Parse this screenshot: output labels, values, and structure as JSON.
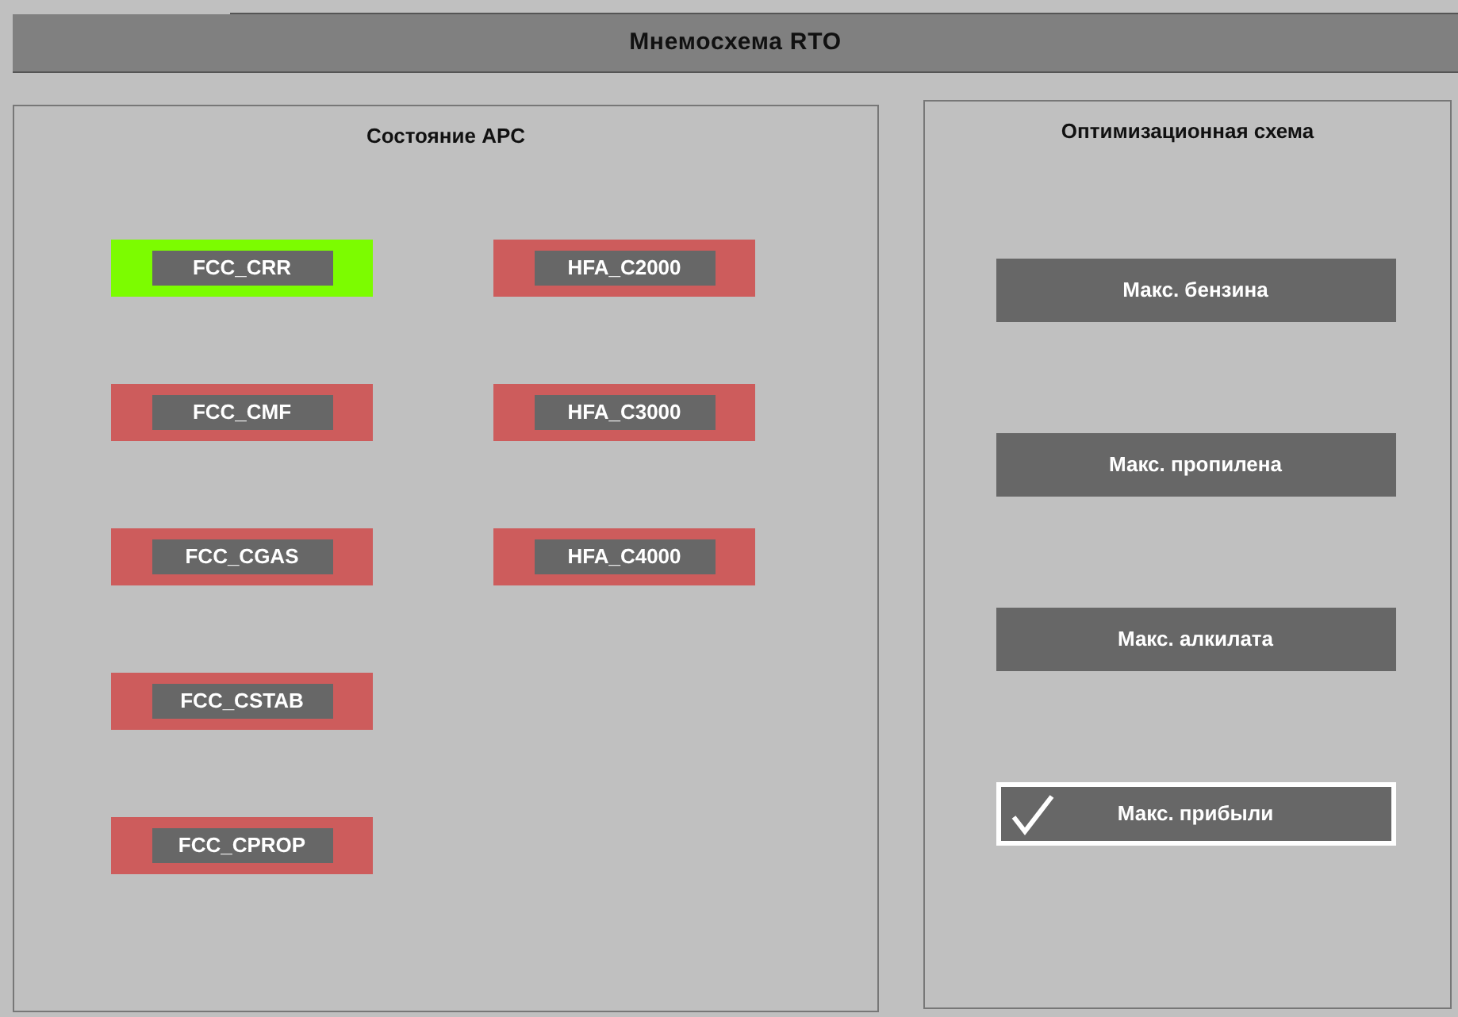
{
  "window": {
    "title": "Мнемосхема RTO"
  },
  "apc_panel": {
    "title": "Состояние APC",
    "columns": [
      [
        {
          "label": "FCC_CRR",
          "color": "#7cfc00"
        },
        {
          "label": "FCC_CMF",
          "color": "#cd5c5c"
        },
        {
          "label": "FCC_CGAS",
          "color": "#cd5c5c"
        },
        {
          "label": "FCC_CSTAB",
          "color": "#cd5c5c"
        },
        {
          "label": "FCC_CPROP",
          "color": "#cd5c5c"
        }
      ],
      [
        {
          "label": "HFA_C2000",
          "color": "#cd5c5c"
        },
        {
          "label": "HFA_C3000",
          "color": "#cd5c5c"
        },
        {
          "label": "HFA_C4000",
          "color": "#cd5c5c"
        }
      ]
    ]
  },
  "optimization_panel": {
    "title": "Оптимизационная схема",
    "options": [
      {
        "label": "Макс. бензина",
        "selected": false
      },
      {
        "label": "Макс. пропилена",
        "selected": false
      },
      {
        "label": "Макс. алкилата",
        "selected": false
      },
      {
        "label": "Макс. прибыли",
        "selected": true
      }
    ]
  }
}
